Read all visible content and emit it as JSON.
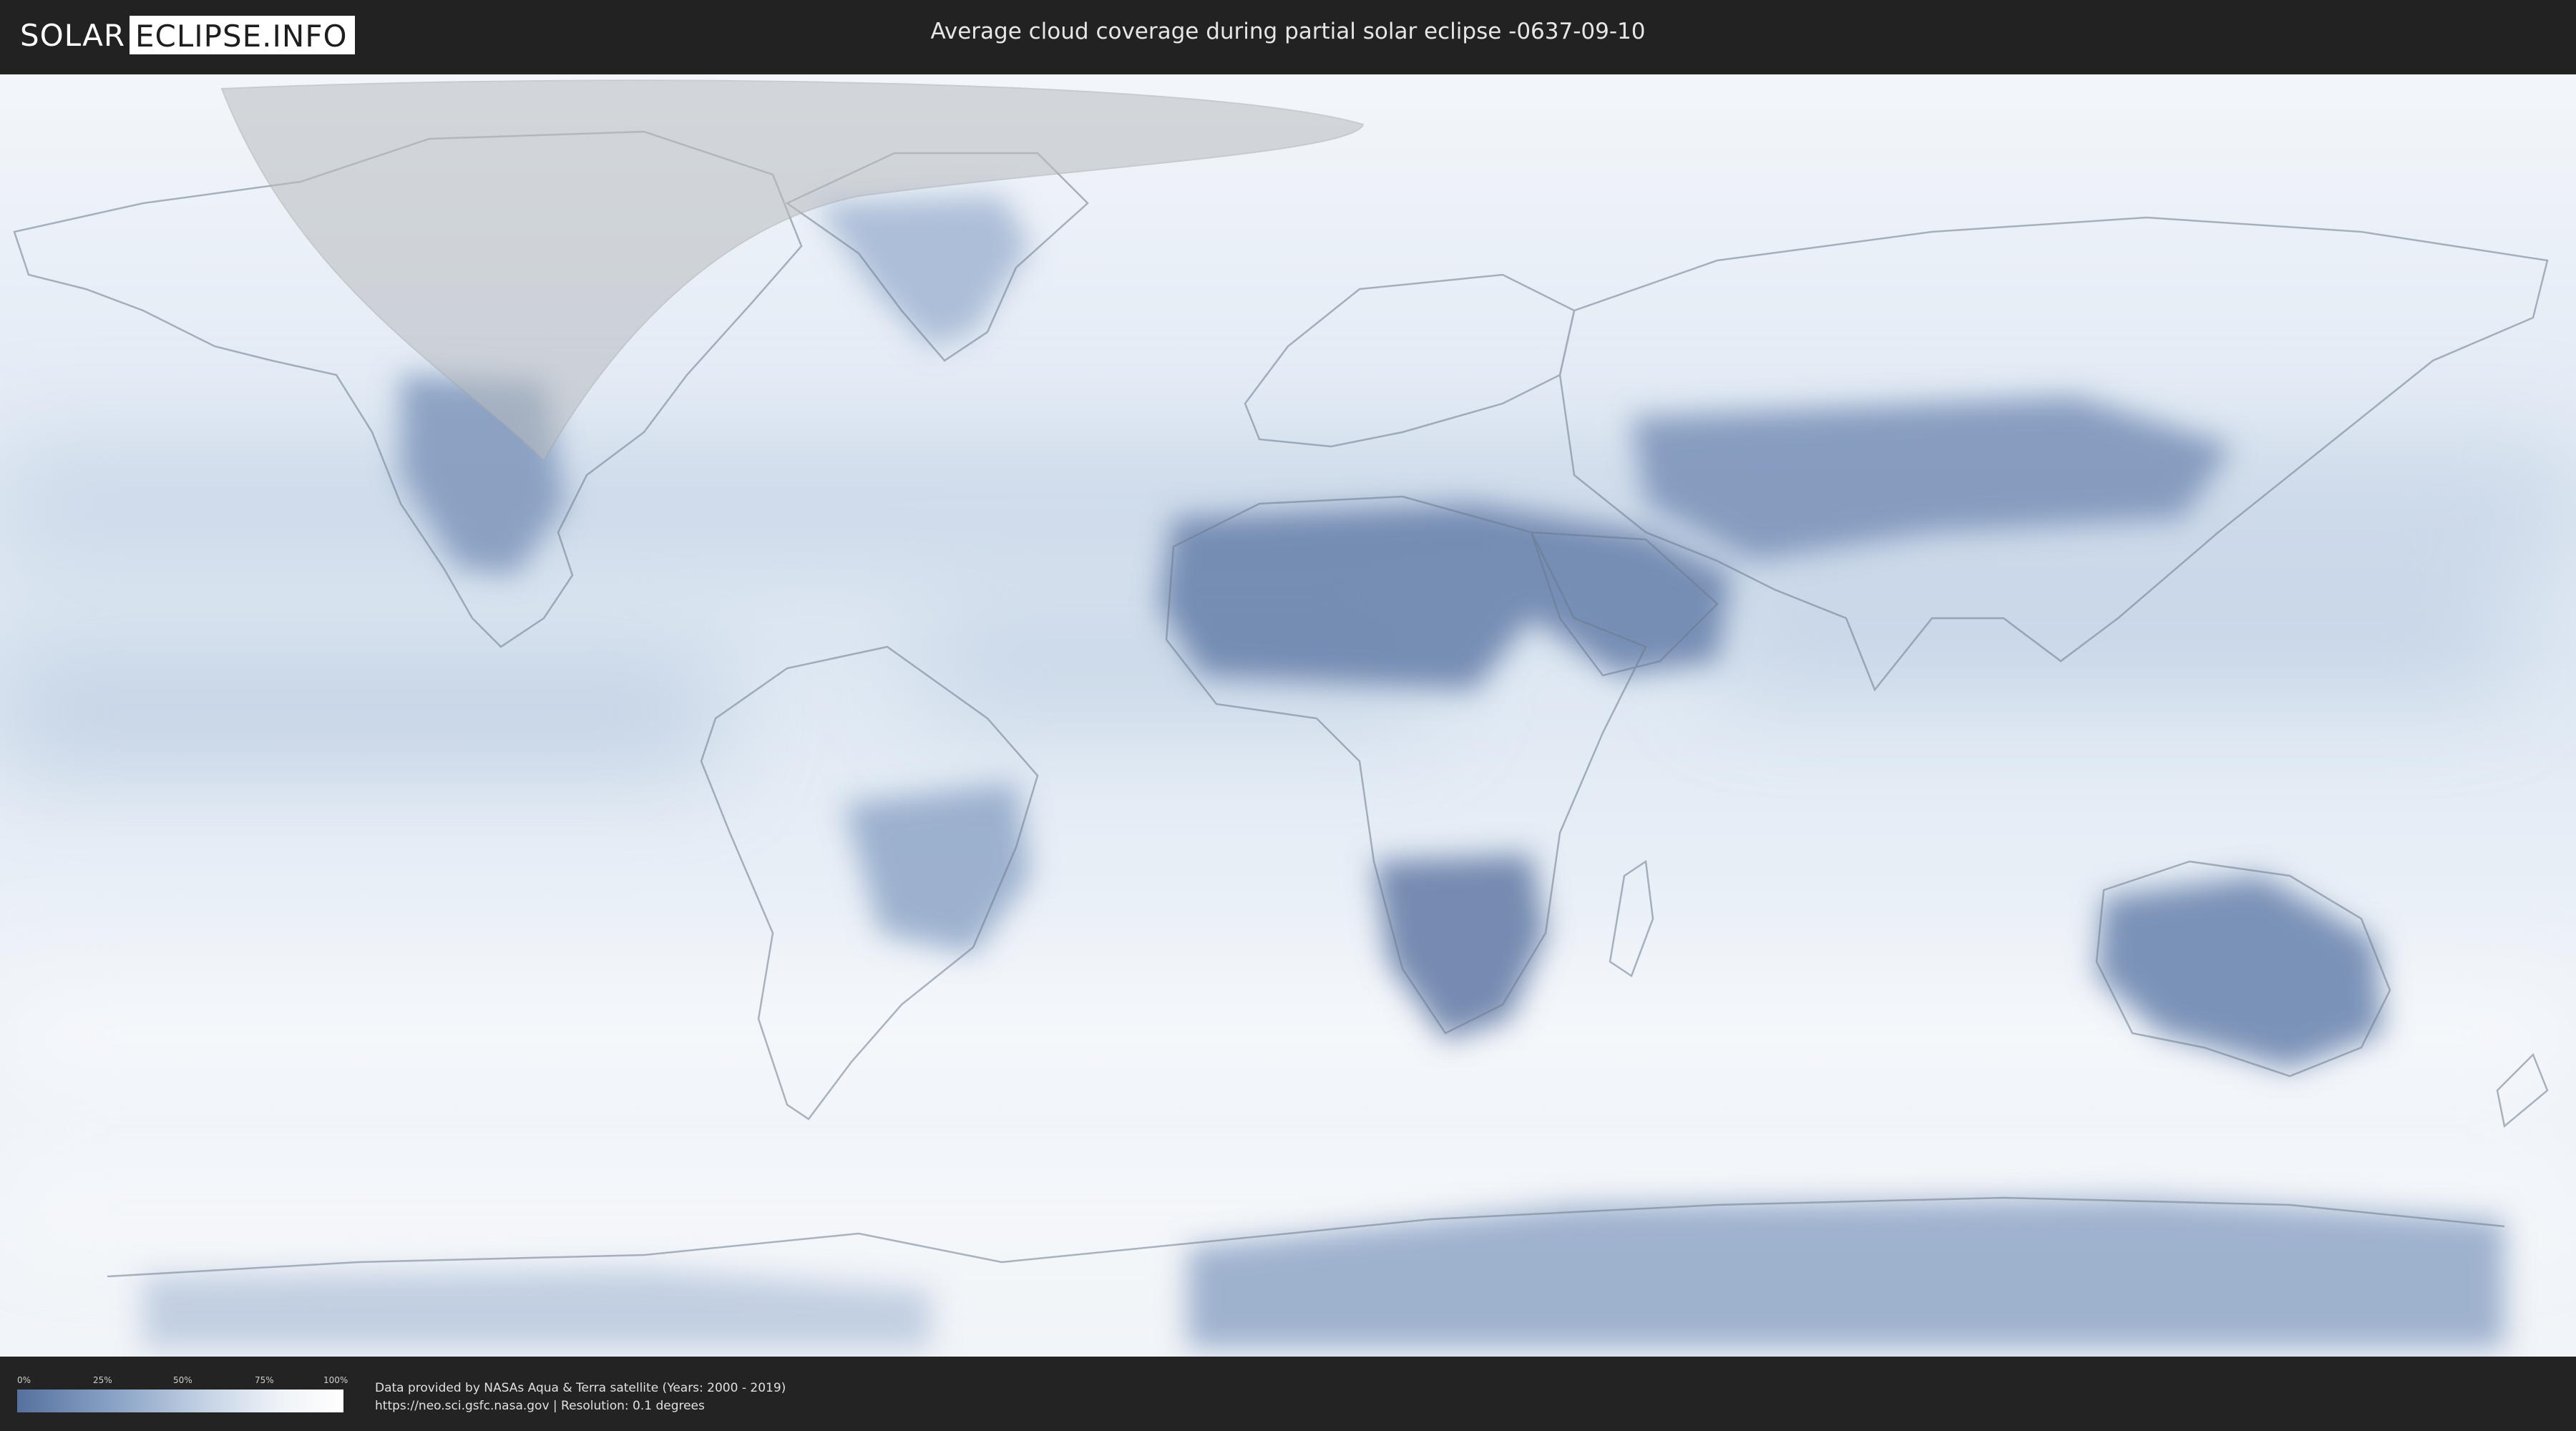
{
  "header": {
    "logo_left": "SOLAR",
    "logo_right": "ECLIPSE.INFO",
    "title": "Average cloud coverage during partial solar eclipse -0637-09-10"
  },
  "legend": {
    "ticks": [
      "0%",
      "25%",
      "50%",
      "75%",
      "100%"
    ],
    "colors": {
      "low": "#56719f",
      "high": "#ffffff"
    }
  },
  "footer": {
    "credit_line1": "Data provided by NASAs Aqua & Terra satellite (Years: 2000 - 2019)",
    "credit_line2": "https://neo.sci.gsfc.nasa.gov | Resolution: 0.1 degrees"
  },
  "map": {
    "colors": {
      "ocean_cloudy": "#eef3f9",
      "clear_sky": "#5f7aa6",
      "land_outline": "#6b7a8c",
      "eclipse_shadow": "#b9bcc0"
    }
  }
}
